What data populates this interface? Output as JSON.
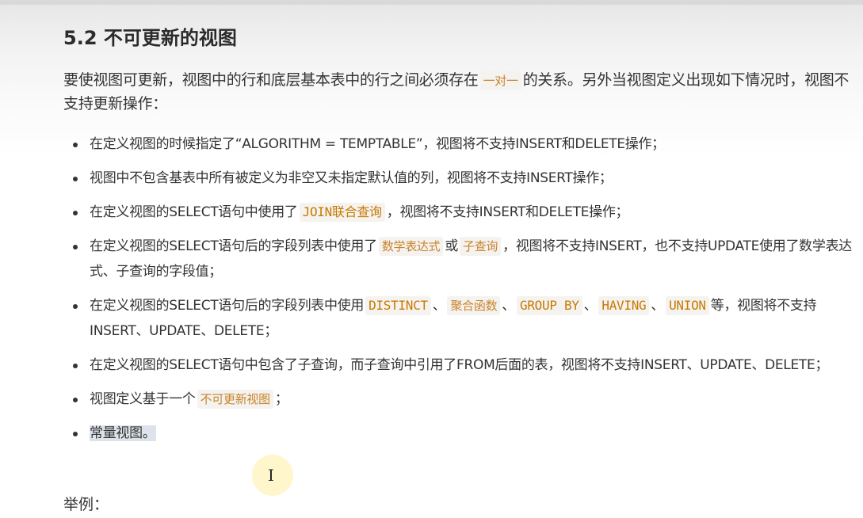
{
  "section": {
    "title": "5.2 不可更新的视图"
  },
  "intro": {
    "part1": "要使视图可更新，视图中的行和底层基本表中的行之间必须存在",
    "code": "一对一",
    "part2": "的关系。另外当视图定义出现如下情况时，视图不支持更新操作："
  },
  "bullets": {
    "b1": {
      "text": "在定义视图的时候指定了“ALGORITHM = TEMPTABLE”，视图将不支持INSERT和DELETE操作；"
    },
    "b2": {
      "text": "视图中不包含基表中所有被定义为非空又未指定默认值的列，视图将不支持INSERT操作；"
    },
    "b3": {
      "pre": "在定义视图的SELECT语句中使用了",
      "code": "JOIN联合查询",
      "post": "，视图将不支持INSERT和DELETE操作；"
    },
    "b4": {
      "pre": "在定义视图的SELECT语句后的字段列表中使用了",
      "code1": "数学表达式",
      "mid": "或",
      "code2": "子查询",
      "post": "，视图将不支持INSERT，也不支持UPDATE使用了数学表达式、子查询的字段值；"
    },
    "b5": {
      "pre": "在定义视图的SELECT语句后的字段列表中使用",
      "code1": "DISTINCT",
      "sep1": "、",
      "code2": "聚合函数",
      "sep2": "、",
      "code3": "GROUP BY",
      "sep3": "、",
      "code4": "HAVING",
      "sep4": "、",
      "code5": "UNION",
      "post": "等，视图将不支持INSERT、UPDATE、DELETE；"
    },
    "b6": {
      "text": "在定义视图的SELECT语句中包含了子查询，而子查询中引用了FROM后面的表，视图将不支持INSERT、UPDATE、DELETE；"
    },
    "b7": {
      "pre": "视图定义基于一个",
      "code": "不可更新视图",
      "post": "；"
    },
    "b8": {
      "text": "常量视图。"
    }
  },
  "example_label": "举例：",
  "cursor": {
    "glyph": "I"
  }
}
